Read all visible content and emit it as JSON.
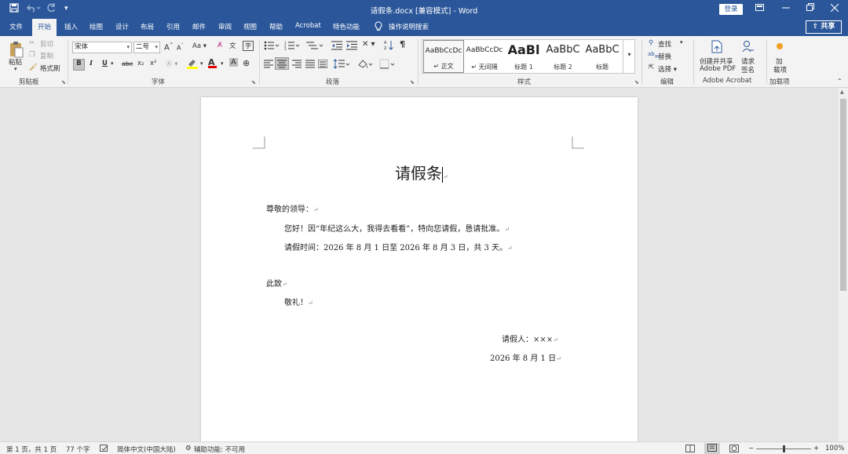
{
  "titlebar": {
    "title": "请假条.docx [兼容模式] - Word",
    "login": "登录",
    "icons": [
      "save-icon",
      "undo-icon",
      "redo-icon",
      "customize-icon",
      "ribbon-display-icon",
      "minimize-icon",
      "restore-icon",
      "close-icon"
    ]
  },
  "tabs": {
    "items": [
      "文件",
      "开始",
      "插入",
      "绘图",
      "设计",
      "布局",
      "引用",
      "邮件",
      "审阅",
      "视图",
      "帮助",
      "Acrobat",
      "特色功能"
    ],
    "active": "开始",
    "search": "操作说明搜索",
    "share": "共享"
  },
  "ribbon": {
    "clipboard": {
      "paste": "粘贴",
      "cut": "剪切",
      "copy": "复制",
      "format_painter": "格式刷",
      "label": "剪贴板"
    },
    "font": {
      "family": "宋体",
      "size": "二号",
      "label": "字体",
      "grow": "A",
      "shrink": "A",
      "case": "Aa",
      "bold": "B",
      "italic": "I",
      "underline": "U",
      "strike": "abc",
      "subscript": "x₂",
      "superscript": "x²",
      "font_color": "A",
      "char_shading": "A",
      "phonetic": "文",
      "char_border": "A",
      "enclose": "字"
    },
    "paragraph": {
      "label": "段落"
    },
    "styles": {
      "label": "样式",
      "items": [
        {
          "sample": "AaBbCcDc",
          "name": "↵ 正文"
        },
        {
          "sample": "AaBbCcDc",
          "name": "↵ 无间隔"
        },
        {
          "sample": "AaBl",
          "name": "标题 1"
        },
        {
          "sample": "AaBbC",
          "name": "标题 2"
        },
        {
          "sample": "AaBbC",
          "name": "标题"
        }
      ]
    },
    "editing": {
      "find": "查找",
      "replace": "替换",
      "select": "选择",
      "label": "编辑"
    },
    "acrobat": {
      "create": "创建并共享",
      "create2": "Adobe PDF",
      "sign": "请求",
      "sign2": "签名",
      "label": "Adobe Acrobat"
    },
    "addins": {
      "add": "加",
      "add2": "载项",
      "label": "加载项"
    }
  },
  "document": {
    "title": "请假条",
    "salutation": "尊敬的领导：",
    "body1": "您好！因“年纪这么大，我得去看看”，特向您请假，恳请批准。",
    "body2": "请假时间：2026 年 8 月 1 日至 2026 年 8 月 3 日，共 3 天。",
    "closing1": "此致",
    "closing2": "敬礼！",
    "signer": "请假人：×××",
    "date": "2026 年 8 月 1 日"
  },
  "statusbar": {
    "page": "第 1 页，共 1 页",
    "words": "77 个字",
    "language": "简体中文(中国大陆)",
    "accessibility": "辅助功能: 不可用",
    "zoom": "100%",
    "zoom_level": 1.0
  },
  "colors": {
    "accent": "#2b579a",
    "ribbon": "#f3f3f3",
    "workspace": "#e6e6e6",
    "font_color_bar": "#e00000",
    "highlight_bar": "#ffff00"
  }
}
